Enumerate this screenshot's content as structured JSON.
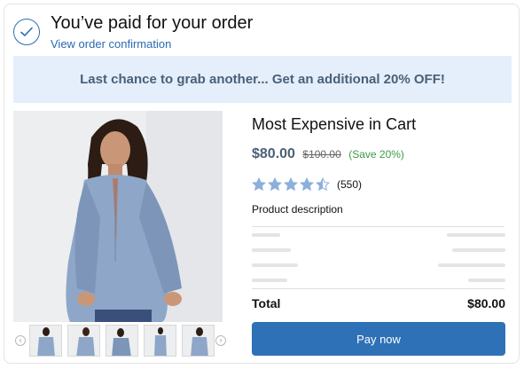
{
  "header": {
    "icon": "check-circle-icon",
    "title": "You’ve paid for your order",
    "link_label": "View order confirmation"
  },
  "banner": {
    "text": "Last chance to grab another... Get an additional 20% OFF!"
  },
  "gallery": {
    "main_image": "product-photo",
    "prev_icon": "chevron-left-icon",
    "next_icon": "chevron-right-icon",
    "thumbnail_count": 5
  },
  "product": {
    "title": "Most Expensive in Cart",
    "price": "$80.00",
    "original_price": "$100.00",
    "savings": "(Save 20%)",
    "rating": 4.5,
    "rating_max": 5,
    "review_count": "(550)",
    "description_label": "Product description"
  },
  "summary": {
    "total_label": "Total",
    "total_value": "$80.00"
  },
  "actions": {
    "pay_label": "Pay now"
  },
  "colors": {
    "accent": "#2f71b6",
    "banner_bg": "#e4effb",
    "banner_text": "#4a6078",
    "star": "#8cb0dc",
    "save_green": "#3e9b47"
  }
}
